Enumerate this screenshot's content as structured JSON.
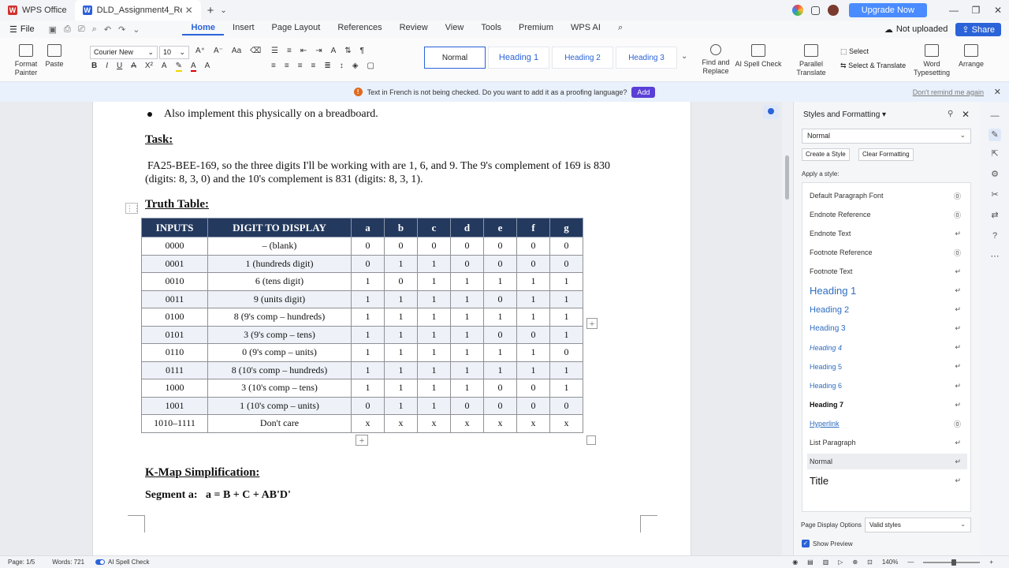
{
  "titlebar": {
    "tabs": [
      {
        "label": "WPS Office"
      },
      {
        "label": "DLD_Assignment4_Reg169..."
      }
    ],
    "upgrade_label": "Upgrade Now"
  },
  "menubar": {
    "file_label": "File",
    "menus": [
      "Home",
      "Insert",
      "Page Layout",
      "References",
      "Review",
      "View",
      "Tools",
      "Premium",
      "WPS AI"
    ],
    "active_menu": "Home",
    "not_uploaded": "Not uploaded",
    "share_label": "Share"
  },
  "ribbon": {
    "format_painter": "Format Painter",
    "paste": "Paste",
    "font_name": "Courier New",
    "font_size": "10",
    "styles": [
      "Normal",
      "Heading 1",
      "Heading 2",
      "Heading 3"
    ],
    "select": "Select",
    "find_replace": "Find and Replace",
    "ai_spell": "AI Spell Check",
    "parallel_translate": "Parallel Translate",
    "select_translate": "Select & Translate",
    "word_typesetting": "Word Typesetting",
    "arrange": "Arrange"
  },
  "notification": {
    "message": "Text in French is not being checked. Do you want to add it as a proofing language?",
    "add_label": "Add",
    "dont_remind": "Don't remind me again"
  },
  "document": {
    "bullet": "Also implement this physically on a breadboard.",
    "task_heading": "Task:",
    "task_para": "FA25-BEE-169, so the three digits I'll be working with are 1, 6, and 9. The 9's complement of 169 is 830 (digits: 8, 3, 0) and the 10's complement is 831 (digits: 8, 3, 1).",
    "tt_heading": "Truth Table:",
    "table": {
      "headers": [
        "INPUTS",
        "DIGIT TO DISPLAY",
        "a",
        "b",
        "c",
        "d",
        "e",
        "f",
        "g"
      ],
      "rows": [
        [
          "0000",
          "– (blank)",
          "0",
          "0",
          "0",
          "0",
          "0",
          "0",
          "0"
        ],
        [
          "0001",
          "1  (hundreds digit)",
          "0",
          "1",
          "1",
          "0",
          "0",
          "0",
          "0"
        ],
        [
          "0010",
          "6  (tens digit)",
          "1",
          "0",
          "1",
          "1",
          "1",
          "1",
          "1"
        ],
        [
          "0011",
          "9  (units digit)",
          "1",
          "1",
          "1",
          "1",
          "0",
          "1",
          "1"
        ],
        [
          "0100",
          "8  (9's comp – hundreds)",
          "1",
          "1",
          "1",
          "1",
          "1",
          "1",
          "1"
        ],
        [
          "0101",
          "3  (9's comp – tens)",
          "1",
          "1",
          "1",
          "1",
          "0",
          "0",
          "1"
        ],
        [
          "0110",
          "0  (9's comp – units)",
          "1",
          "1",
          "1",
          "1",
          "1",
          "1",
          "0"
        ],
        [
          "0111",
          "8  (10's comp – hundreds)",
          "1",
          "1",
          "1",
          "1",
          "1",
          "1",
          "1"
        ],
        [
          "1000",
          "3  (10's comp – tens)",
          "1",
          "1",
          "1",
          "1",
          "0",
          "0",
          "1"
        ],
        [
          "1001",
          "1  (10's comp – units)",
          "0",
          "1",
          "1",
          "0",
          "0",
          "0",
          "0"
        ],
        [
          "1010–1111",
          "Don't care",
          "x",
          "x",
          "x",
          "x",
          "x",
          "x",
          "x"
        ]
      ]
    },
    "kmap_heading": "K-Map Simplification:",
    "segment_a": "Segment a:   a = B + C + AB'D'"
  },
  "styles_panel": {
    "title": "Styles and Formatting",
    "current_style": "Normal",
    "create_style": "Create a Style",
    "clear_formatting": "Clear Formatting",
    "apply_label": "Apply a style:",
    "styles": [
      {
        "name": "Default Paragraph Font",
        "kind": "char"
      },
      {
        "name": "Endnote Reference",
        "kind": "char"
      },
      {
        "name": "Endnote Text",
        "kind": "para"
      },
      {
        "name": "Footnote Reference",
        "kind": "char"
      },
      {
        "name": "Footnote Text",
        "kind": "para"
      },
      {
        "name": "Heading 1",
        "kind": "para"
      },
      {
        "name": "Heading 2",
        "kind": "para"
      },
      {
        "name": "Heading 3",
        "kind": "para"
      },
      {
        "name": "Heading 4",
        "kind": "para"
      },
      {
        "name": "Heading 5",
        "kind": "para"
      },
      {
        "name": "Heading 6",
        "kind": "para"
      },
      {
        "name": "Heading 7",
        "kind": "para"
      },
      {
        "name": "Hyperlink",
        "kind": "char"
      },
      {
        "name": "List Paragraph",
        "kind": "para"
      },
      {
        "name": "Normal",
        "kind": "para"
      },
      {
        "name": "Title",
        "kind": "para"
      }
    ],
    "page_display_label": "Page Display Options",
    "page_display_value": "Valid styles",
    "show_preview": "Show Preview"
  },
  "status": {
    "page": "Page: 1/5",
    "words": "Words: 721",
    "ai_spell": "AI Spell Check",
    "zoom": "140%"
  },
  "colors": {
    "accent": "#2b63d8",
    "table_header": "#24395e",
    "heading_blue": "#2e6dbf"
  }
}
